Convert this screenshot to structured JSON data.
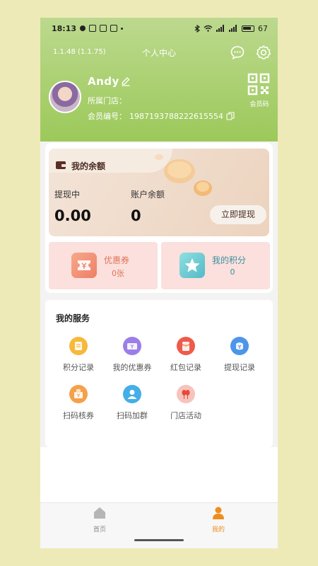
{
  "status_bar": {
    "time": "18:13",
    "battery": "67"
  },
  "header": {
    "version": "1.1.48 (1.1.75)",
    "title": "个人中心"
  },
  "profile": {
    "name": "Andy",
    "store_label": "所属门店：",
    "member_label": "会员编号：",
    "member_id": "1987193788222615554",
    "qr_label": "会员码"
  },
  "balance": {
    "title": "我的余额",
    "withdrawing_label": "提现中",
    "withdrawing_value": "0.00",
    "account_label": "账户余额",
    "account_value": "0",
    "withdraw_button": "立即提现"
  },
  "tiles": {
    "coupon_title": "优惠券",
    "coupon_value": "0张",
    "points_title": "我的积分",
    "points_value": "0"
  },
  "services": {
    "title": "我的服务",
    "items": [
      {
        "label": "积分记录",
        "icon": "points-record-icon",
        "color": "#f6b93b"
      },
      {
        "label": "我的优惠券",
        "icon": "coupon-icon",
        "color": "#9b7ee8"
      },
      {
        "label": "红包记录",
        "icon": "red-packet-icon",
        "color": "#ef5a4b"
      },
      {
        "label": "提现记录",
        "icon": "withdraw-record-icon",
        "color": "#4d95ea"
      },
      {
        "label": "扫码核券",
        "icon": "scan-coupon-icon",
        "color": "#f5a04a"
      },
      {
        "label": "扫码加群",
        "icon": "scan-group-icon",
        "color": "#45aee6"
      },
      {
        "label": "门店活动",
        "icon": "store-activity-icon",
        "color": "#f08a7a"
      }
    ]
  },
  "tabbar": {
    "home_label": "首页",
    "mine_label": "我的",
    "active_color": "#f08c1a"
  }
}
